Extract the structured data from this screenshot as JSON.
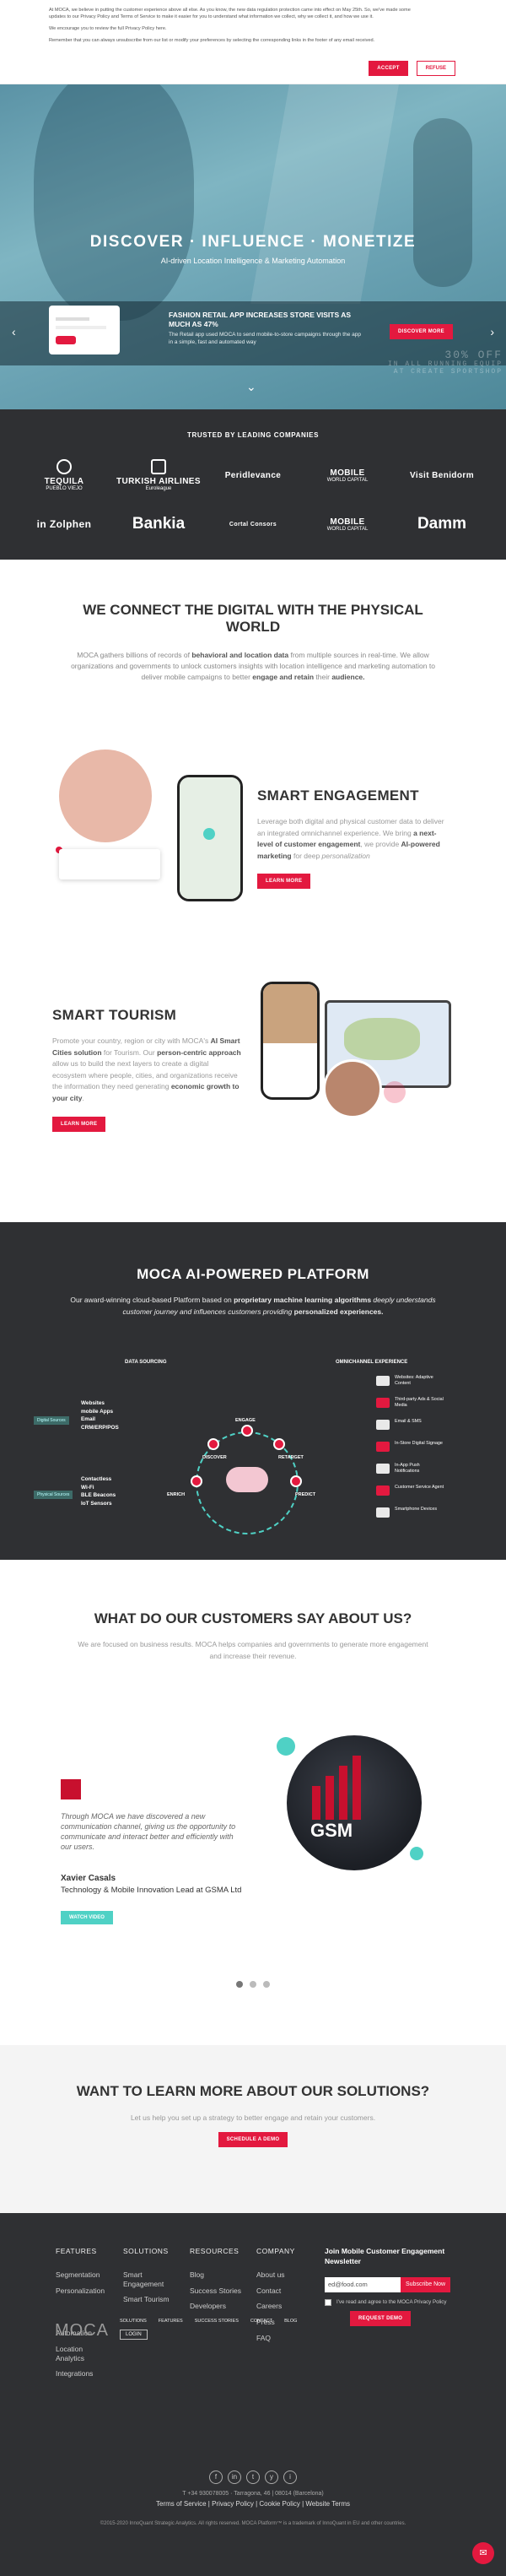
{
  "cookie": {
    "p1": "At MOCA, we believe in putting the customer experience above all else. As you know, the new data regulation protection came into effect on May 25th. So, we've made some updates to our Privacy Policy and Terms of Service to make it easier for you to understand what information we collect, why we collect it, and how we use it.",
    "p2": "We encourage you to review the full Privacy Policy here.",
    "p3": "Remember that you can always unsubscribe from our list or modify your preferences by selecting the corresponding links in the footer of any email received.",
    "accept": "ACCEPT",
    "refuse": "REFUSE"
  },
  "hero": {
    "title": "DISCOVER · INFLUENCE · MONETIZE",
    "subtitle": "AI-driven Location Intelligence & Marketing Automation",
    "news_title": "FASHION RETAIL APP INCREASES STORE VISITS AS MUCH AS 47%",
    "news_desc": "The Retail app used MOCA to send mobile-to-store campaigns through the app in a simple, fast and automated way",
    "discover_more": "DISCOVER MORE",
    "prev": "‹",
    "next": "›",
    "scroll": "⌄",
    "ghost1": "30% OFF",
    "ghost2": "IN ALL RUNNING EQUIP",
    "ghost3": "AT CREATE SPORTSHOP"
  },
  "trusted": {
    "title": "TRUSTED BY LEADING COMPANIES",
    "logos": [
      {
        "t1": "TEQUILA",
        "t2": "PUEBLO VIEJO"
      },
      {
        "t1": "TURKISH AIRLINES",
        "t2": "Euroleague"
      },
      {
        "t1": "Peridlevance",
        "t2": ""
      },
      {
        "t1": "MOBILE",
        "t2": "WORLD CAPITAL"
      },
      {
        "t1": "Visit Benidorm",
        "t2": ""
      },
      {
        "t1": "in Zolphen",
        "t2": ""
      },
      {
        "t1": "Bankia",
        "t2": ""
      },
      {
        "t1": "Cortal Consors",
        "t2": ""
      },
      {
        "t1": "MOBILE",
        "t2": "WORLD CAPITAL"
      },
      {
        "t1": "Damm",
        "t2": ""
      }
    ]
  },
  "connect": {
    "title": "WE CONNECT THE DIGITAL WITH THE PHYSICAL WORLD",
    "p_a": "MOCA gathers billions of records of ",
    "p_b": "behavioral and location data",
    "p_c": " from multiple sources in real-time. We allow organizations and governments to unlock customers insights with location intelligence and marketing automation to deliver mobile campaigns to better ",
    "p_d": "engage and retain",
    "p_e": " their ",
    "p_f": "audience."
  },
  "engagement": {
    "title": "SMART ENGAGEMENT",
    "p_a": "Leverage both digital and physical customer data to deliver an integrated omnichannel experience. We bring ",
    "p_b": "a next-level of customer engagement",
    "p_c": ", we provide ",
    "p_d": "AI-powered marketing",
    "p_e": " for deep ",
    "p_f": "personalization",
    "cta": "LEARN MORE"
  },
  "tourism": {
    "title": "SMART TOURISM",
    "p_a": "Promote your country, region or city with MOCA's ",
    "p_b": "AI Smart Cities solution",
    "p_c": " for Tourism. Our ",
    "p_d": "person-centric approach",
    "p_e": " allow us to build the next layers to create a digital ecosystem where people, cities, and organizations receive the information they need generating ",
    "p_f": "economic growth to your city",
    "p_g": ".",
    "cta": "LEARN MORE"
  },
  "platform": {
    "title": "MOCA AI-POWERED PLATFORM",
    "p_a": "Our award-winning cloud-based Platform based on ",
    "p_b": "proprietary machine learning algorithms",
    "p_c": " deeply understands customer journey and influences customers providing ",
    "p_d": "personalized experiences.",
    "data_sourcing": "DATA SOURCING",
    "omnichannel": "OMNICHANNEL EXPERIENCE",
    "sources1": [
      "Websites",
      "mobile Apps",
      "Email",
      "CRM/ERP/POS"
    ],
    "sources2": [
      "Contactless",
      "Wi-Fi",
      "BLE Beacons",
      "IoT Sensors"
    ],
    "tag1": "Digital Sources",
    "tag2": "Physical Sources",
    "nodes": [
      "DISCOVER",
      "ENGAGE",
      "INFLUENCE",
      "ANALYSE",
      "RETARGET",
      "PREDICT",
      "ENRICH"
    ],
    "outputs": [
      "Websites: Adaptive Content",
      "Third-party Ads & Social Media",
      "Email & SMS",
      "In-Store Digital Signage",
      "In-App Push Notifications",
      "Customer Service Agent",
      "Smartphone Devices"
    ]
  },
  "testimonials": {
    "title": "WHAT DO OUR CUSTOMERS SAY ABOUT US?",
    "lead": "We are focused on business results. MOCA helps companies and governments to generate more engagement and increase their revenue.",
    "quote": "Through MOCA we have discovered a new communication channel, giving us the opportunity to communicate and interact better and efficiently with our users.",
    "name": "Xavier Casals",
    "role": "Technology & Mobile Innovation Lead at GSMA Ltd",
    "watch": "WATCH VIDEO",
    "photo_text": "GSM"
  },
  "learn": {
    "title": "WANT TO LEARN MORE ABOUT OUR SOLUTIONS?",
    "text": "Let us help you set up a strategy to better engage and retain your customers.",
    "cta": "SCHEDULE A DEMO"
  },
  "footer": {
    "features": {
      "title": "FEATURES",
      "items": [
        "Segmentation",
        "Personalization",
        "Automation",
        "Location Analytics",
        "Integrations"
      ]
    },
    "solutions": {
      "title": "SOLUTIONS",
      "items": [
        "Smart Engagement",
        "Smart Tourism"
      ]
    },
    "resources": {
      "title": "RESOURCES",
      "items": [
        "Blog",
        "Success Stories",
        "Developers"
      ]
    },
    "company": {
      "title": "COMPANY",
      "items": [
        "About us",
        "Contact",
        "Careers",
        "Press",
        "FAQ"
      ]
    },
    "newsletter_title": "Join Mobile Customer Engagement Newsletter",
    "email_value": "ed@food.com",
    "subscribe": "Subscribe Now",
    "agree": "I've read and agree to the MOCA Privacy Policy",
    "request": "REQUEST DEMO",
    "logo": "MOCA",
    "login": "LOGIN",
    "smallnav": [
      "SOLUTIONS",
      "FEATURES",
      "SUCCESS STORIES",
      "CONTACT",
      "BLOG"
    ],
    "social": [
      "f",
      "in",
      "t",
      "y",
      "i"
    ],
    "address": "T +34 930078005 · Tarragona, 46 | 08014 (Barcelona)",
    "links": "Terms of Service | Privacy Policy | Cookie Policy | Website Terms",
    "copy": "©2015-2020 InnoQuant Strategic Analytics. All rights reserved. MOCA Platform™ is a trademark of InnoQuant in EU and other countries."
  },
  "chat_icon": "✉"
}
